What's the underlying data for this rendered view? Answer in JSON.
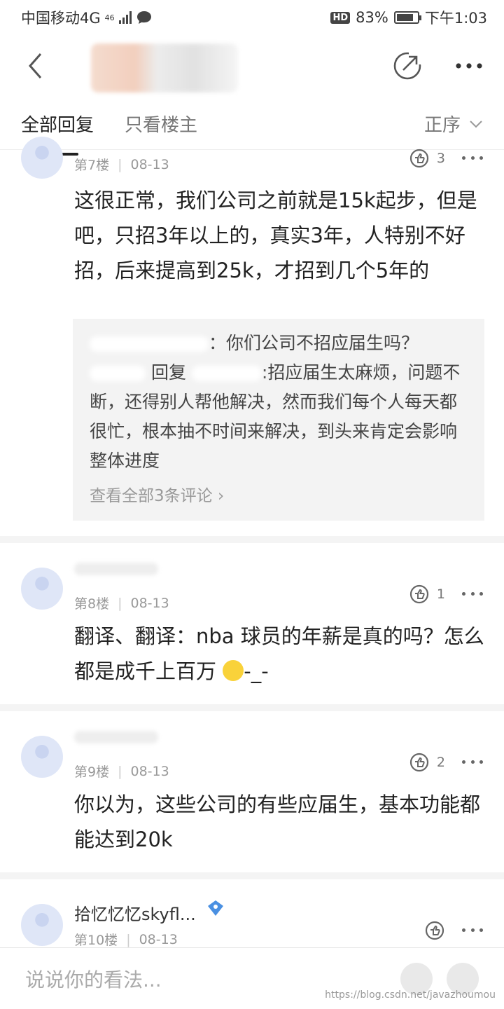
{
  "status": {
    "carrier": "中国移动4G",
    "network": "46",
    "battery_pct": "83%",
    "time": "下午1:03",
    "hd": "HD"
  },
  "tabs": {
    "all": "全部回复",
    "owner": "只看楼主",
    "sort": "正序"
  },
  "posts": [
    {
      "floor": "第7楼",
      "date": "08-13",
      "likes": "3",
      "content": "这很正常，我们公司之前就是15k起步，但是吧，只招3年以上的，真实3年，人特别不好招，后来提高到25k，才招到几个5年的",
      "quote": {
        "q1_suffix": "：你们公司不招应届生吗？",
        "q2_reply": "回复",
        "q2_text": ":招应届生太麻烦，问题不断，还得别人帮他解决，然而我们每个人每天都很忙，根本抽不时间来解决，到头来肯定会影响整体进度",
        "view_all": "查看全部3条评论"
      }
    },
    {
      "floor": "第8楼",
      "date": "08-13",
      "likes": "1",
      "content": "翻译、翻译：nba 球员的年薪是真的吗？怎么都是成千上百万",
      "content_tail": "-_-"
    },
    {
      "floor": "第9楼",
      "date": "08-13",
      "likes": "2",
      "content": "你以为，这些公司的有些应届生，基本功能都能达到20k"
    },
    {
      "username": "拾忆忆忆skyfl...",
      "floor": "第10楼",
      "date": "08-13",
      "likes": ""
    }
  ],
  "input": {
    "placeholder": "说说你的看法..."
  },
  "watermark": "https://blog.csdn.net/javazhoumou",
  "colors": {
    "accent": "#222222",
    "muted": "#999999",
    "quote_bg": "#f3f3f3"
  }
}
